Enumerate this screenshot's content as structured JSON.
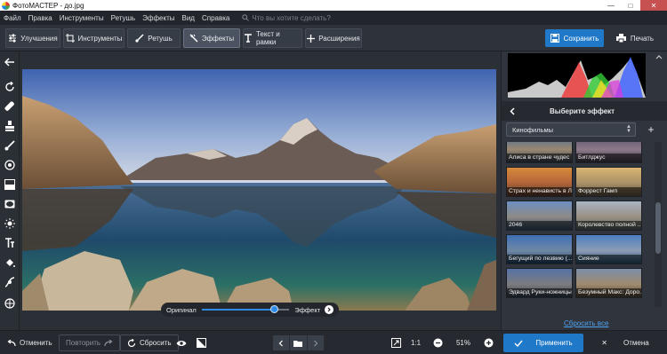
{
  "window": {
    "title": "ФотоМАСТЕР - до.jpg"
  },
  "menu": {
    "items": [
      "Файл",
      "Правка",
      "Инструменты",
      "Ретушь",
      "Эффекты",
      "Вид",
      "Справка"
    ],
    "search_placeholder": "Что вы хотите сделать?"
  },
  "tabs": [
    {
      "label": "Улучшения",
      "icon": "sliders-icon"
    },
    {
      "label": "Инструменты",
      "icon": "crop-icon"
    },
    {
      "label": "Ретушь",
      "icon": "brush-icon"
    },
    {
      "label": "Эффекты",
      "icon": "magic-wand-icon",
      "active": true
    },
    {
      "label": "Текст и рамки",
      "icon": "text-icon"
    },
    {
      "label": "Расширения",
      "icon": "plus-icon"
    }
  ],
  "toolbar": {
    "save_label": "Сохранить",
    "print_label": "Печать"
  },
  "canvas": {
    "slider_left_label": "Оригинал",
    "slider_right_label": "Эффект",
    "effect_strength": 0.82
  },
  "effects_panel": {
    "title": "Выберите эффект",
    "category": "Кинофильмы",
    "thumbnails": [
      "Алиса в стране чудес",
      "Битлджус",
      "Страх и ненависть в Л...",
      "Форрест Гамп",
      "2046",
      "Королевство полной ...",
      "Бегущий по лезвию (...",
      "Сияние",
      "Эдвард Руки-ножницы",
      "Безумный Макс: Доро..."
    ],
    "reset_all_label": "Сбросить все"
  },
  "bottombar": {
    "undo_label": "Отменить",
    "redo_label": "Повторить",
    "reset_label": "Сбросить",
    "ratio_label": "1:1",
    "zoom_value": "51%",
    "apply_label": "Применить",
    "cancel_label": "Отмена"
  },
  "colors": {
    "accent": "#1f78c8",
    "panel": "#30353d",
    "link": "#4fa3f0"
  }
}
